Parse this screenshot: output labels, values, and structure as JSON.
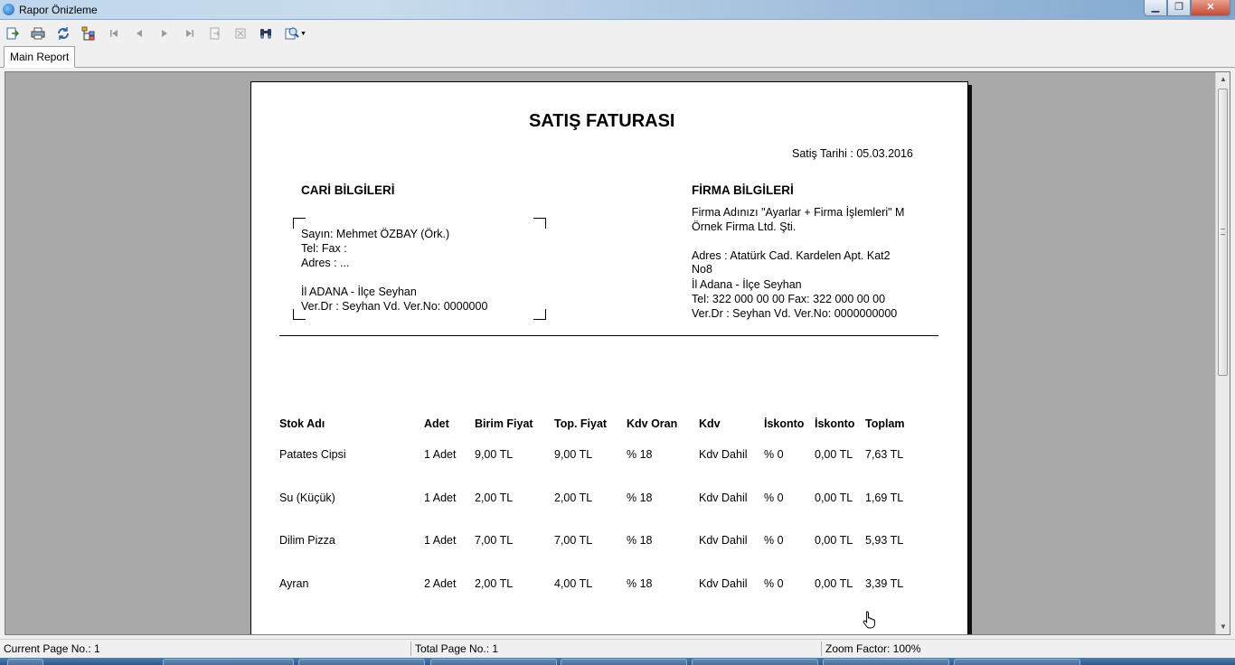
{
  "window": {
    "title": "Rapor Önizleme"
  },
  "toolbar": {
    "icons": [
      "export-icon",
      "print-icon",
      "refresh-icon",
      "group-tree-icon",
      "first-page-icon",
      "previous-page-icon",
      "next-page-icon",
      "last-page-icon",
      "go-to-page-icon",
      "stop-icon",
      "find-icon",
      "zoom-icon"
    ]
  },
  "tabs": [
    {
      "label": "Main Report"
    }
  ],
  "report": {
    "title": "SATIŞ FATURASI",
    "date_line": "Satiş Tarihi : 05.03.2016",
    "customer": {
      "heading": "CARİ BİLGİLERİ",
      "line1": "Sayın: Mehmet ÖZBAY (Örk.)",
      "line2": "Tel:  Fax :",
      "line3": "Adres : ...",
      "line4": "İl ADANA - İlçe Seyhan",
      "line5": "Ver.Dr : Seyhan Vd. Ver.No: 0000000"
    },
    "company": {
      "heading": "FİRMA BİLGİLERİ",
      "line1": "Firma Adınızı \"Ayarlar + Firma İşlemleri\" M",
      "line2": "Örnek Firma Ltd. Şti.",
      "line3": "Adres : Atatürk Cad. Kardelen Apt. Kat2",
      "line4": "No8",
      "line5": "İl Adana - İlçe Seyhan",
      "line6": "Tel: 322 000 00 00 Fax: 322 000 00 00",
      "line7": "Ver.Dr : Seyhan Vd. Ver.No: 0000000000"
    },
    "columns": [
      "Stok Adı",
      "Adet",
      "Birim Fiyat",
      "Top. Fiyat",
      "Kdv Oran",
      "Kdv",
      "İskonto",
      "İskonto",
      "Toplam"
    ],
    "rows": [
      [
        "Patates Cipsi",
        "1 Adet",
        "9,00 TL",
        "9,00 TL",
        "% 18",
        "Kdv Dahil",
        "% 0",
        "0,00 TL",
        "7,63 TL"
      ],
      [
        "Su (Küçük)",
        "1 Adet",
        "2,00 TL",
        "2,00 TL",
        "% 18",
        "Kdv Dahil",
        "% 0",
        "0,00 TL",
        "1,69 TL"
      ],
      [
        "Dilim Pizza",
        "1 Adet",
        "7,00 TL",
        "7,00 TL",
        "% 18",
        "Kdv Dahil",
        "% 0",
        "0,00 TL",
        "5,93 TL"
      ],
      [
        "Ayran",
        "2 Adet",
        "2,00 TL",
        "4,00 TL",
        "% 18",
        "Kdv Dahil",
        "% 0",
        "0,00 TL",
        "3,39 TL"
      ]
    ]
  },
  "status": {
    "current_page": "Current Page No.: 1",
    "total_page": "Total Page No.: 1",
    "zoom": "Zoom Factor: 100%"
  }
}
